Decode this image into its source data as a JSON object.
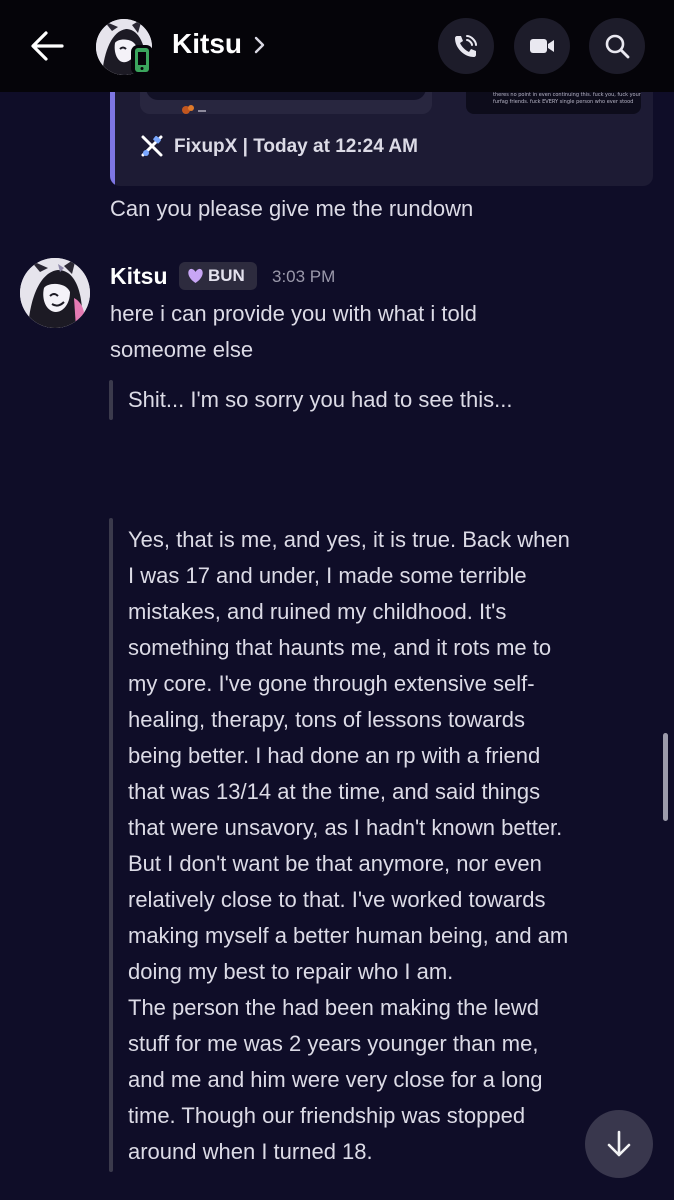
{
  "header": {
    "contact_name": "Kitsu",
    "icons": [
      "back-arrow-icon",
      "chevron-right-icon",
      "phone-icon",
      "video-camera-icon",
      "search-icon",
      "mobile-icon"
    ]
  },
  "embed": {
    "source": "FixupX | Today at 12:24 AM",
    "source_icon": "fixupx-logo-icon",
    "image_caption_line1": "theres no point in even continuing this. fuck you, fuck your",
    "image_caption_line2": "furfag friends. fuck EVERY single person who ever stood"
  },
  "previous_message": {
    "text": "Can you please give me the rundown"
  },
  "message": {
    "author": "Kitsu",
    "tag": "BUN",
    "time": "3:03 PM",
    "lines": [
      "here i can provide you with what i told",
      "someome else"
    ],
    "quote1": "Shit... I'm so sorry you had to see this...",
    "quote2_lines": [
      "Yes, that is me, and yes, it is true. Back when",
      "I was 17 and under, I made some terrible",
      "mistakes, and ruined my childhood. It's",
      "something that haunts me, and it rots me to",
      "my core. I've gone through extensive self-",
      "healing, therapy, tons of lessons towards",
      "being better. I had done an rp with a friend",
      "that was 13/14 at the time, and said things",
      "that were unsavory, as I hadn't known better.",
      "But I don't want be that anymore, nor even",
      "relatively close to that. I've worked towards",
      "making myself a better human being, and am",
      "doing my best to repair who I am.",
      "The person the had been making the lewd",
      "stuff for me was 2 years younger than me,",
      "and me and him were very close for a long",
      "time. Though our friendship was stopped",
      "around when I turned 18."
    ]
  },
  "colors": {
    "background": "#0f0d28",
    "header": "#050409",
    "embed_accent": "#7e76e3",
    "tag_bg": "#2d2b3e",
    "online_mobile": "#3ba55d"
  }
}
